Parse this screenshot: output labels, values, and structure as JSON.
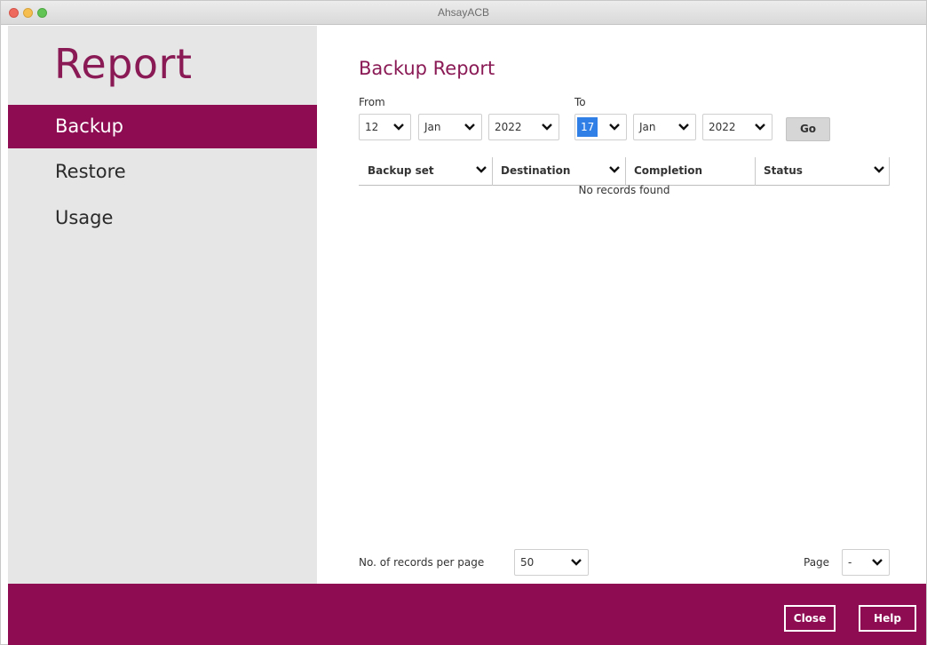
{
  "window": {
    "title": "AhsayACB"
  },
  "sidebar": {
    "title": "Report",
    "items": [
      {
        "label": "Backup",
        "active": true
      },
      {
        "label": "Restore",
        "active": false
      },
      {
        "label": "Usage",
        "active": false
      }
    ]
  },
  "main": {
    "title": "Backup Report",
    "from_label": "From",
    "to_label": "To",
    "from": {
      "day": "12",
      "month": "Jan",
      "year": "2022"
    },
    "to": {
      "day": "17",
      "month": "Jan",
      "year": "2022"
    },
    "go_label": "Go",
    "table": {
      "columns": [
        "Backup set",
        "Destination",
        "Completion",
        "Status"
      ],
      "empty_message": "No records found"
    },
    "records_per_page_label": "No. of records per page",
    "records_per_page_value": "50",
    "page_label": "Page",
    "page_value": "-"
  },
  "footer": {
    "close_label": "Close",
    "help_label": "Help"
  },
  "colors": {
    "accent": "#8e0d52",
    "title_text": "#8a1a55",
    "selection": "#2f7fe6",
    "sidebar_bg": "#e6e6e6"
  },
  "icons": {
    "dropdown": "chevron-down-icon"
  }
}
